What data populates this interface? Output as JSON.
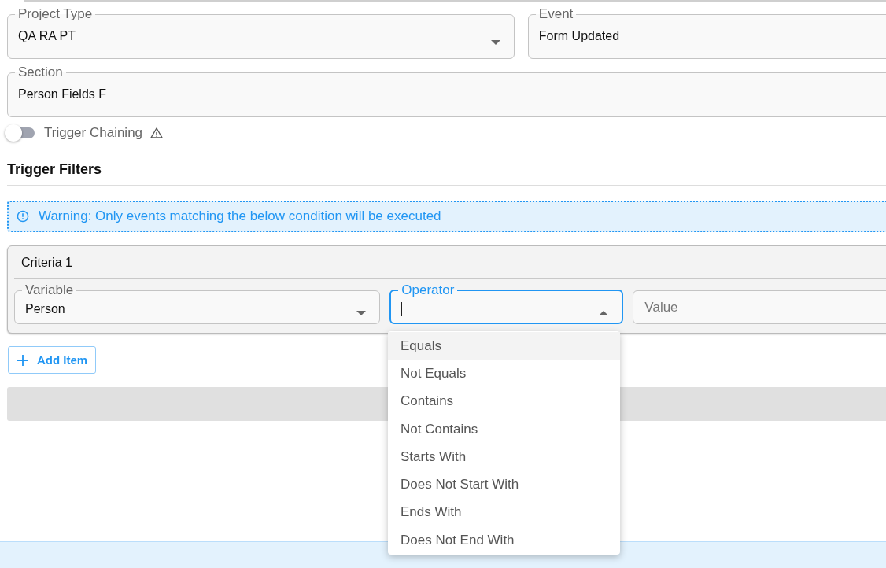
{
  "top_fields": [
    {
      "label": "Project Type",
      "value": "QA RA PT",
      "kind": "select"
    },
    {
      "label": "Event",
      "value": "Form Updated",
      "kind": "text"
    }
  ],
  "section_field": {
    "label": "Section",
    "value": "Person Fields F"
  },
  "trigger_chaining": {
    "label": "Trigger Chaining",
    "on": false
  },
  "filters": {
    "title": "Trigger Filters",
    "warning": "Warning: Only events matching the below condition will be executed"
  },
  "criteria": {
    "title": "Criteria 1",
    "variable": {
      "label": "Variable",
      "value": "Person"
    },
    "operator": {
      "label": "Operator",
      "focused": true,
      "expanded": true,
      "options": [
        {
          "label": "Equals",
          "highlighted": true
        },
        {
          "label": "Not Equals",
          "highlighted": false
        },
        {
          "label": "Contains",
          "highlighted": false
        },
        {
          "label": "Not Contains",
          "highlighted": false
        },
        {
          "label": "Starts With",
          "highlighted": false
        },
        {
          "label": "Does Not Start With",
          "highlighted": false
        },
        {
          "label": "Ends With",
          "highlighted": false
        },
        {
          "label": "Does Not End With",
          "highlighted": false
        }
      ]
    },
    "value": {
      "placeholder": "Value"
    }
  },
  "add_button": "Add Item"
}
